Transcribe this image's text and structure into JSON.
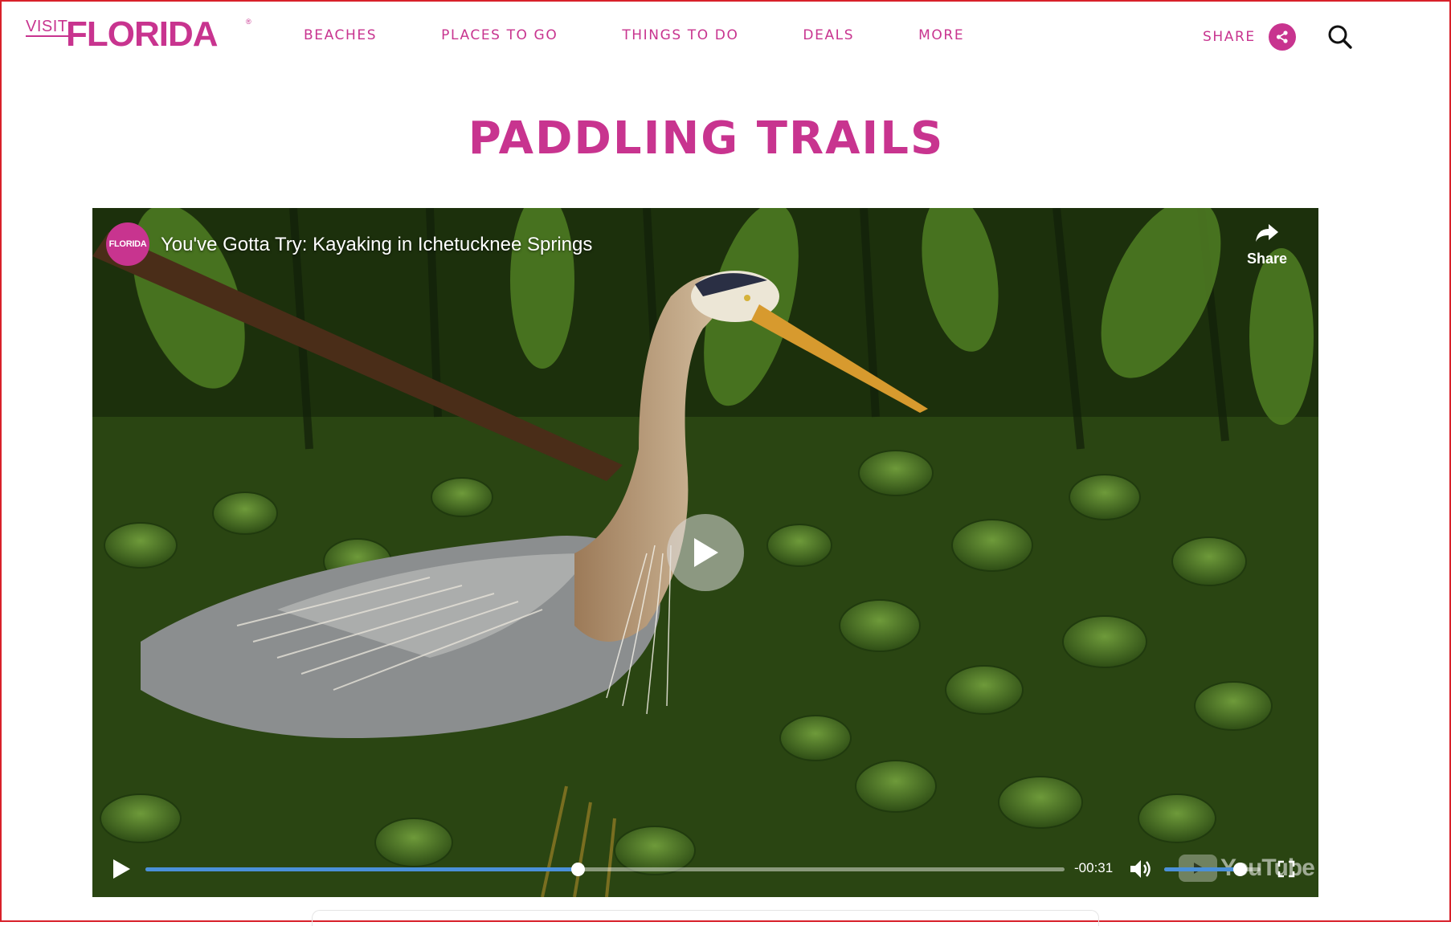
{
  "header": {
    "logo": {
      "visit": "VISIT",
      "florida": "FLORIDA",
      "reg": "®"
    },
    "nav": [
      {
        "label": "BEACHES"
      },
      {
        "label": "PLACES TO GO"
      },
      {
        "label": "THINGS TO DO"
      },
      {
        "label": "DEALS"
      },
      {
        "label": "MORE"
      }
    ],
    "share_label": "SHARE"
  },
  "page": {
    "title": "PADDLING TRAILS"
  },
  "video": {
    "channel_avatar_text": "FLORIDA",
    "title": "You've Gotta Try: Kayaking in Ichetucknee Springs",
    "share_label": "Share",
    "time_remaining": "-00:31",
    "progress": 0.47,
    "volume": 0.78,
    "youtube_wordmark": "YouTube"
  },
  "colors": {
    "brand": "#c8348f",
    "progress": "#4a90d9"
  },
  "icons": {
    "share": "share-icon",
    "search": "search-icon",
    "play": "play-icon",
    "volume": "volume-icon",
    "fullscreen": "fullscreen-icon"
  }
}
